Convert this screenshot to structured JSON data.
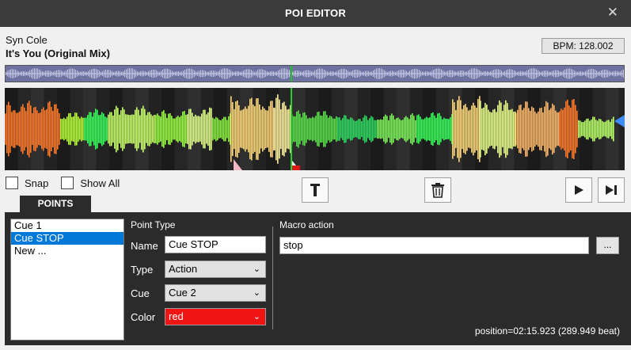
{
  "window": {
    "title": "POI EDITOR",
    "close_icon": "close-icon"
  },
  "track": {
    "artist": "Syn Cole",
    "title": "It's You (Original Mix)",
    "bpm": "BPM: 128.002"
  },
  "options": {
    "snap_label": "Snap",
    "show_all_label": "Show All"
  },
  "toolbar": {
    "marker_icon": "marker-icon",
    "delete_icon": "trash-icon",
    "play_icon": "play-icon",
    "next_icon": "skip-next-icon"
  },
  "tabs": {
    "points": "POINTS"
  },
  "points": {
    "items": [
      "Cue 1",
      "Cue STOP",
      "New ..."
    ],
    "selected": "Cue STOP"
  },
  "point_type": {
    "heading": "Point Type",
    "name_label": "Name",
    "name_value": "Cue STOP",
    "type_label": "Type",
    "type_value": "Action",
    "cue_label": "Cue",
    "cue_value": "Cue 2",
    "color_label": "Color",
    "color_value": "red"
  },
  "macro": {
    "heading": "Macro action",
    "value": "stop",
    "browse_label": "..."
  },
  "status": {
    "position": "position=02:15.923 (289.949 beat)"
  },
  "colors": {
    "titlebar": "#3b3b3b",
    "panel": "#2b2b2b",
    "selection": "#0078d7",
    "color_select": "#f01414",
    "overview": "#6e72a0"
  }
}
